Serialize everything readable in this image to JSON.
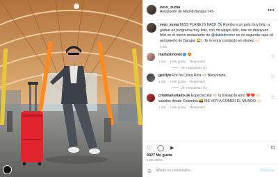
{
  "author": {
    "username": "vero_zuma",
    "location": "Aeropuerto de Madrid-Barajas T4S"
  },
  "caption": {
    "username": "vero_zuma",
    "text": "MISS PLANE IS BACK ✈️ Rumbo a un país muy feliz, a grabar un programa muy feliz, con mi equipo feliz, tras un desayuno feliz en el nuevo restaurante de",
    "mention": "@dabizdiverxo",
    "text2": "en mi segunda casa (el aeropuerto de Barajas 😂). Te lo estoy contando en stories 🙌🏻",
    "time": "1 día"
  },
  "comments": [
    {
      "username": "martasimonet",
      "text": "😍",
      "time": "1 día",
      "likes": "1 Me gusta",
      "reply": "Responder",
      "view_replies": "Ver respuestas (1)"
    },
    {
      "username": "geeflyn",
      "text": "Por fin Costa Rica 🙌🏻 Bienvenida",
      "time": "1 día",
      "likes": "1 Me gusta",
      "reply": "Responder",
      "view_replies": "Ver respuestas (1)"
    },
    {
      "username": "cristinahurtado.ok",
      "text": "Espectacular 👏🏻 tu trabajo lo amo ❤️❤️🙌🏻 saludos desde Colombia 🇨🇴 ME VOY A COMER EL MUNDO 🙌🏻",
      "time": "1 día",
      "likes": "1 Me gusta",
      "reply": "Responder"
    }
  ],
  "likes_count": "4927 Me gusta",
  "post_date": "1 DE ABRIL",
  "add_comment": {
    "placeholder": "Añade un comentario...",
    "publish": "Publicar"
  },
  "icons": {
    "more": "more-options-icon",
    "like": "heart-icon",
    "comment": "comment-icon",
    "share": "paper-plane-icon",
    "save": "bookmark-icon",
    "emoji": "smiley-icon"
  }
}
